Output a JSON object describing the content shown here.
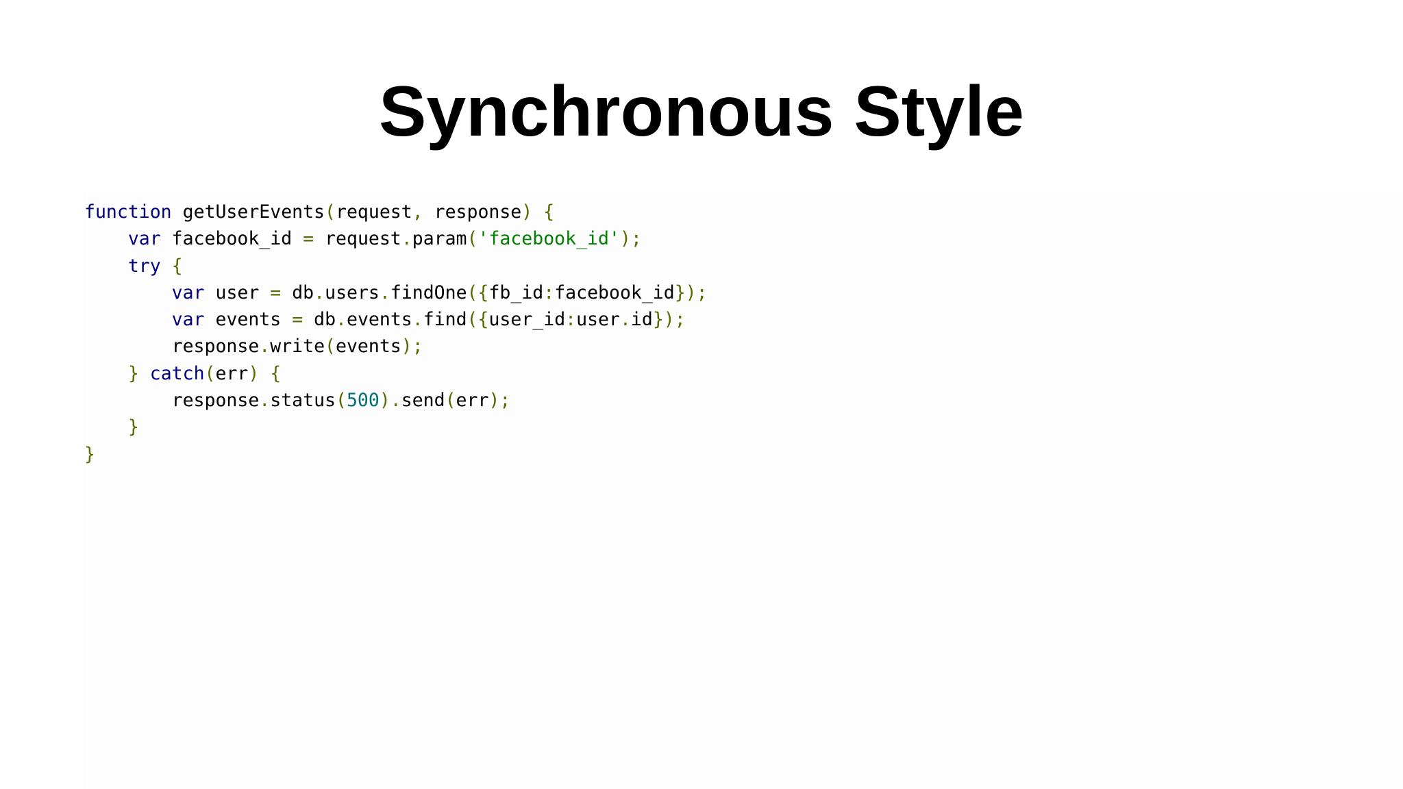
{
  "slide": {
    "title": "Synchronous Style"
  },
  "colors": {
    "background": "#ffffff",
    "keyword": "#00007f",
    "string": "#008000",
    "number": "#007070",
    "punctuation": "#5a6a00",
    "identifier": "#000000"
  },
  "code": {
    "language": "javascript",
    "lines": [
      [
        {
          "t": "kw",
          "v": "function"
        },
        {
          "t": "ws",
          "v": " "
        },
        {
          "t": "id",
          "v": "getUserEvents"
        },
        {
          "t": "pun",
          "v": "("
        },
        {
          "t": "id",
          "v": "request"
        },
        {
          "t": "pun",
          "v": ","
        },
        {
          "t": "ws",
          "v": " "
        },
        {
          "t": "id",
          "v": "response"
        },
        {
          "t": "pun",
          "v": ")"
        },
        {
          "t": "ws",
          "v": " "
        },
        {
          "t": "pun",
          "v": "{"
        }
      ],
      [
        {
          "t": "ws",
          "v": "    "
        },
        {
          "t": "kw",
          "v": "var"
        },
        {
          "t": "ws",
          "v": " "
        },
        {
          "t": "id",
          "v": "facebook_id"
        },
        {
          "t": "ws",
          "v": " "
        },
        {
          "t": "pun",
          "v": "="
        },
        {
          "t": "ws",
          "v": " "
        },
        {
          "t": "id",
          "v": "request"
        },
        {
          "t": "pun",
          "v": "."
        },
        {
          "t": "id",
          "v": "param"
        },
        {
          "t": "pun",
          "v": "("
        },
        {
          "t": "str",
          "v": "'facebook_id'"
        },
        {
          "t": "pun",
          "v": ");"
        }
      ],
      [
        {
          "t": "ws",
          "v": "    "
        },
        {
          "t": "kw",
          "v": "try"
        },
        {
          "t": "ws",
          "v": " "
        },
        {
          "t": "pun",
          "v": "{"
        }
      ],
      [
        {
          "t": "ws",
          "v": "        "
        },
        {
          "t": "kw",
          "v": "var"
        },
        {
          "t": "ws",
          "v": " "
        },
        {
          "t": "id",
          "v": "user"
        },
        {
          "t": "ws",
          "v": " "
        },
        {
          "t": "pun",
          "v": "="
        },
        {
          "t": "ws",
          "v": " "
        },
        {
          "t": "id",
          "v": "db"
        },
        {
          "t": "pun",
          "v": "."
        },
        {
          "t": "id",
          "v": "users"
        },
        {
          "t": "pun",
          "v": "."
        },
        {
          "t": "id",
          "v": "findOne"
        },
        {
          "t": "pun",
          "v": "({"
        },
        {
          "t": "id",
          "v": "fb_id"
        },
        {
          "t": "pun",
          "v": ":"
        },
        {
          "t": "id",
          "v": "facebook_id"
        },
        {
          "t": "pun",
          "v": "});"
        }
      ],
      [
        {
          "t": "ws",
          "v": "        "
        },
        {
          "t": "kw",
          "v": "var"
        },
        {
          "t": "ws",
          "v": " "
        },
        {
          "t": "id",
          "v": "events"
        },
        {
          "t": "ws",
          "v": " "
        },
        {
          "t": "pun",
          "v": "="
        },
        {
          "t": "ws",
          "v": " "
        },
        {
          "t": "id",
          "v": "db"
        },
        {
          "t": "pun",
          "v": "."
        },
        {
          "t": "id",
          "v": "events"
        },
        {
          "t": "pun",
          "v": "."
        },
        {
          "t": "id",
          "v": "find"
        },
        {
          "t": "pun",
          "v": "({"
        },
        {
          "t": "id",
          "v": "user_id"
        },
        {
          "t": "pun",
          "v": ":"
        },
        {
          "t": "id",
          "v": "user"
        },
        {
          "t": "pun",
          "v": "."
        },
        {
          "t": "id",
          "v": "id"
        },
        {
          "t": "pun",
          "v": "});"
        }
      ],
      [
        {
          "t": "ws",
          "v": "        "
        },
        {
          "t": "id",
          "v": "response"
        },
        {
          "t": "pun",
          "v": "."
        },
        {
          "t": "id",
          "v": "write"
        },
        {
          "t": "pun",
          "v": "("
        },
        {
          "t": "id",
          "v": "events"
        },
        {
          "t": "pun",
          "v": ");"
        }
      ],
      [
        {
          "t": "ws",
          "v": "    "
        },
        {
          "t": "pun",
          "v": "}"
        },
        {
          "t": "ws",
          "v": " "
        },
        {
          "t": "kw",
          "v": "catch"
        },
        {
          "t": "pun",
          "v": "("
        },
        {
          "t": "id",
          "v": "err"
        },
        {
          "t": "pun",
          "v": ")"
        },
        {
          "t": "ws",
          "v": " "
        },
        {
          "t": "pun",
          "v": "{"
        }
      ],
      [
        {
          "t": "ws",
          "v": "        "
        },
        {
          "t": "id",
          "v": "response"
        },
        {
          "t": "pun",
          "v": "."
        },
        {
          "t": "id",
          "v": "status"
        },
        {
          "t": "pun",
          "v": "("
        },
        {
          "t": "num",
          "v": "500"
        },
        {
          "t": "pun",
          "v": ")."
        },
        {
          "t": "id",
          "v": "send"
        },
        {
          "t": "pun",
          "v": "("
        },
        {
          "t": "id",
          "v": "err"
        },
        {
          "t": "pun",
          "v": ");"
        }
      ],
      [
        {
          "t": "ws",
          "v": "    "
        },
        {
          "t": "pun",
          "v": "}"
        }
      ],
      [
        {
          "t": "pun",
          "v": "}"
        }
      ]
    ]
  }
}
